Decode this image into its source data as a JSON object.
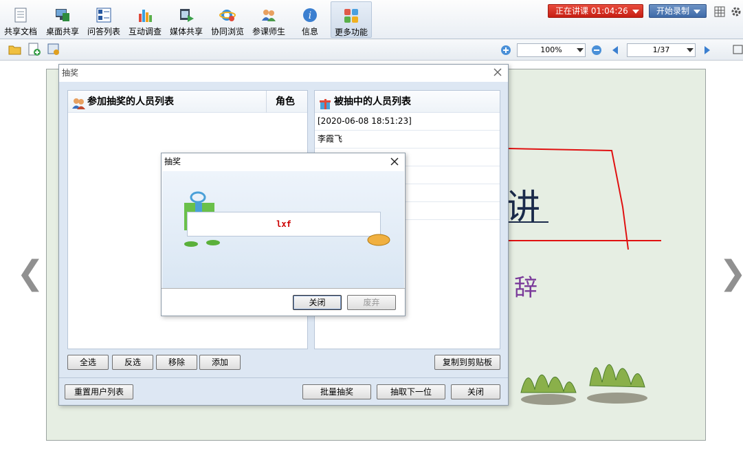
{
  "toolbar": {
    "items": [
      {
        "label": "共享文档",
        "icon": "document-icon"
      },
      {
        "label": "桌面共享",
        "icon": "desktop-share-icon"
      },
      {
        "label": "问答列表",
        "icon": "qa-list-icon"
      },
      {
        "label": "互动调查",
        "icon": "survey-chart-icon"
      },
      {
        "label": "媒体共享",
        "icon": "media-share-icon"
      },
      {
        "label": "协同浏览",
        "icon": "ie-browser-icon"
      },
      {
        "label": "参课师生",
        "icon": "people-icon"
      },
      {
        "label": "信息",
        "icon": "info-icon"
      },
      {
        "label": "更多功能",
        "icon": "more-apps-icon"
      }
    ],
    "live_status": "正在讲课 01:04:26",
    "record_label": "开始录制"
  },
  "bar2": {
    "zoom": "100%",
    "page": "1/37"
  },
  "slide": {
    "text1": "讲",
    "text2": "辞"
  },
  "lottery_dialog": {
    "title": "抽奖",
    "participants_header": "参加抽奖的人员列表",
    "role_header": "角色",
    "winners_header": "被抽中的人员列表",
    "winners_rows": [
      "[2020-06-08 18:51:23]",
      "李霞飞",
      "",
      "",
      "",
      ""
    ],
    "buttons": {
      "select_all": "全选",
      "invert": "反选",
      "remove": "移除",
      "add": "添加",
      "copy": "复制到剪贴板",
      "reset": "重置用户列表",
      "batch": "批量抽奖",
      "next": "抽取下一位",
      "close": "关闭"
    }
  },
  "result_dialog": {
    "title": "抽奖",
    "result": "lxf",
    "close_label": "关闭",
    "discard_label": "废弃"
  },
  "colors": {
    "accent_red": "#d81e12",
    "record_blue": "#3e6aa8",
    "result_text": "#cc0000"
  }
}
